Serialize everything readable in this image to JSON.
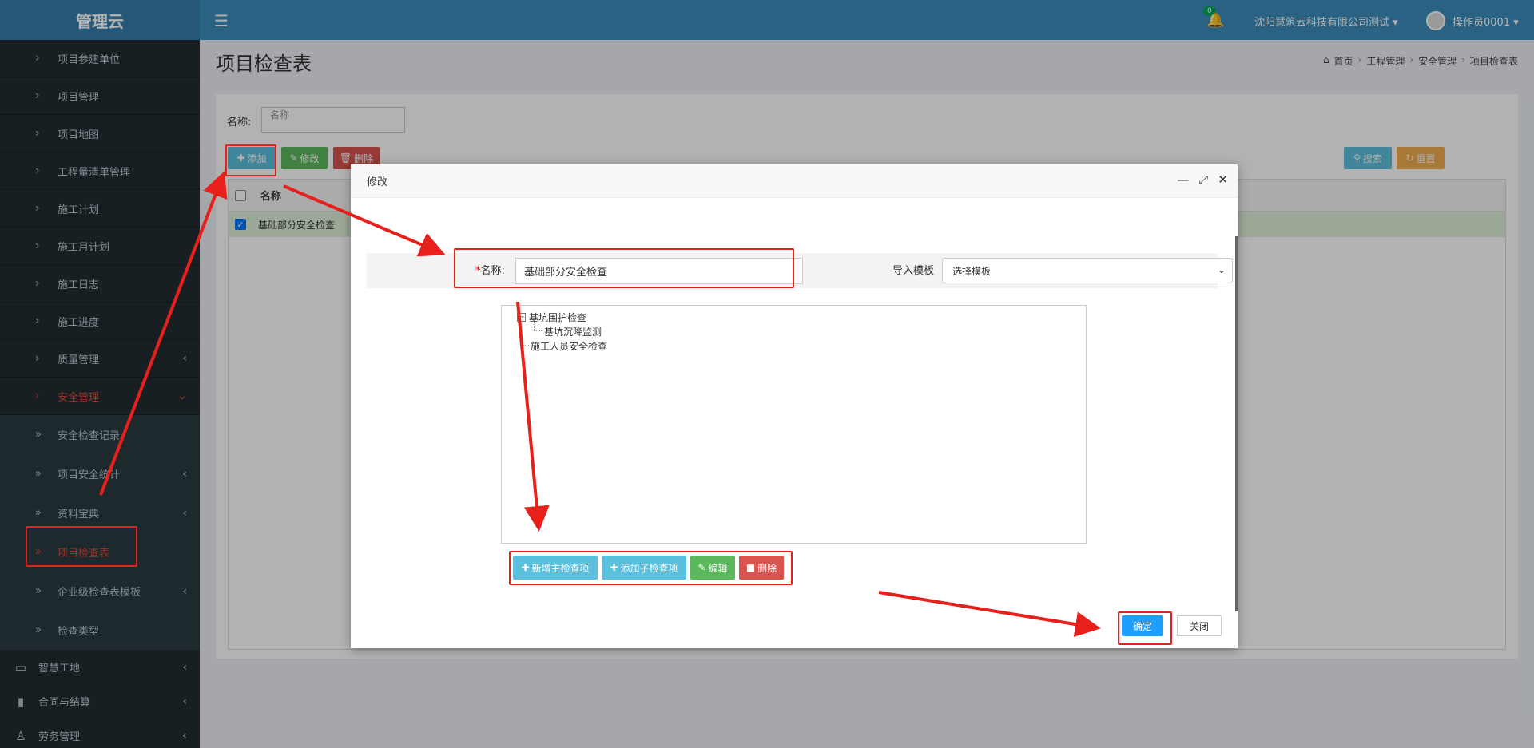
{
  "app": {
    "title": "管理云"
  },
  "sidebar": {
    "items": [
      {
        "label": "项目参建单位"
      },
      {
        "label": "项目管理"
      },
      {
        "label": "项目地图"
      },
      {
        "label": "工程量清单管理"
      },
      {
        "label": "施工计划"
      },
      {
        "label": "施工月计划"
      },
      {
        "label": "施工日志"
      },
      {
        "label": "施工进度"
      },
      {
        "label": "质量管理"
      },
      {
        "label": "安全管理"
      }
    ],
    "sub_items": [
      {
        "label": "安全检查记录"
      },
      {
        "label": "项目安全统计"
      },
      {
        "label": "资料宝典"
      },
      {
        "label": "项目检查表"
      },
      {
        "label": "企业级检查表模板"
      },
      {
        "label": "检查类型"
      }
    ],
    "top_items": [
      {
        "label": "智慧工地"
      },
      {
        "label": "合同与结算"
      },
      {
        "label": "劳务管理"
      }
    ]
  },
  "header": {
    "notification_count": "0",
    "company": "沈阳慧筑云科技有限公司测试",
    "user": "操作员0001"
  },
  "page": {
    "title": "项目检查表",
    "breadcrumb": [
      "首页",
      "工程管理",
      "安全管理",
      "项目检查表"
    ]
  },
  "filter": {
    "label": "名称:",
    "placeholder": "名称"
  },
  "toolbar": {
    "add": "添加",
    "edit": "修改",
    "delete": "删除",
    "search": "搜索",
    "reset": "重置"
  },
  "table": {
    "header": "名称",
    "rows": [
      {
        "name": "基础部分安全检查",
        "checked": true
      }
    ]
  },
  "modal": {
    "title": "修改",
    "name_label": "名称:",
    "required_mark": "*",
    "name_value": "基础部分安全检查",
    "template_label": "导入模板",
    "template_value": "选择模板",
    "tree": {
      "nodes": [
        {
          "label": "基坑围护检查",
          "children": [
            {
              "label": "基坑沉降监测"
            }
          ]
        },
        {
          "label": "施工人员安全检查"
        }
      ]
    },
    "tree_buttons": {
      "add_main": "新增主检查项",
      "add_child": "添加子检查项",
      "edit": "编辑",
      "delete": "删除"
    },
    "ok": "确定",
    "close": "关闭"
  },
  "colors": {
    "sidebar_bg": "#222d32",
    "header_bg": "#3c8dbc",
    "annotation_red": "#e8201c",
    "primary_blue": "#1e9fff"
  }
}
